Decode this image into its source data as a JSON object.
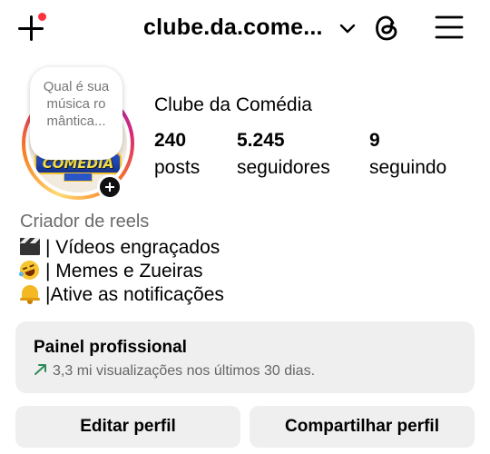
{
  "header": {
    "username": "clube.da.come...",
    "icons": [
      "plus-icon",
      "chevron-down-icon",
      "threads-icon",
      "hamburger-menu-icon"
    ],
    "notification_dot_color": "#ff3040"
  },
  "profile": {
    "note": "Qual é sua música ro mântica...",
    "avatar_logo_text": "COMEDIA",
    "display_name": "Clube da Comédia",
    "stats": [
      {
        "value": "240",
        "label": "posts"
      },
      {
        "value": "5.245",
        "label": "seguidores"
      },
      {
        "value": "9",
        "label": "seguindo"
      }
    ]
  },
  "bio": {
    "category": "Criador de reels",
    "lines": [
      {
        "emoji": "clapper-board-icon",
        "text": "| Vídeos engraçados"
      },
      {
        "emoji": "laughing-face-icon",
        "text": "| Memes e Zueiras"
      },
      {
        "emoji": "bell-icon",
        "text": "|Ative as notificações"
      }
    ]
  },
  "panel": {
    "title": "Painel profissional",
    "subtitle": "3,3 mi visualizações nos últimos 30 dias.",
    "trend_color": "#2e8b57"
  },
  "buttons": {
    "edit": "Editar perfil",
    "share": "Compartilhar perfil"
  }
}
